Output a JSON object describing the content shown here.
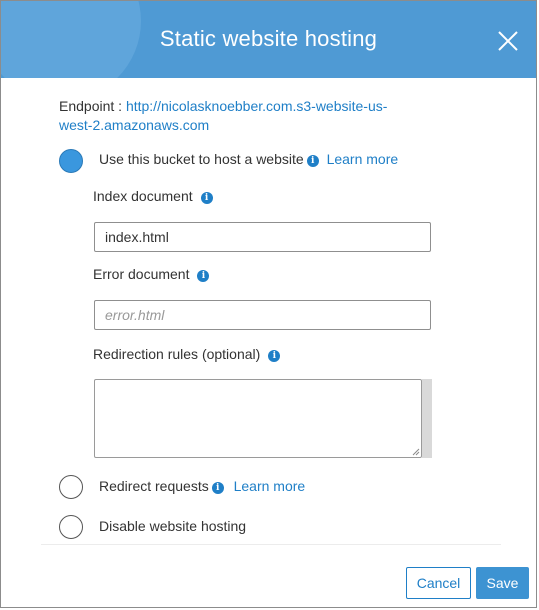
{
  "dialog": {
    "title": "Static website hosting",
    "endpoint_label": "Endpoint : ",
    "endpoint_url_line1": "http://nicolasknoebber.com.s3-website-us-",
    "endpoint_url_line2": "west-2.amazonaws.com"
  },
  "options": {
    "host": {
      "label": "Use this bucket to host a website",
      "learn_more": "Learn more",
      "selected": true
    },
    "redirect": {
      "label": "Redirect requests",
      "learn_more": "Learn more",
      "selected": false
    },
    "disable": {
      "label": "Disable website hosting",
      "selected": false
    }
  },
  "fields": {
    "index_document": {
      "label": "Index document",
      "value": "index.html"
    },
    "error_document": {
      "label": "Error document",
      "value": "",
      "placeholder": "error.html"
    },
    "redirection_rules": {
      "label": "Redirection rules (optional)",
      "value": ""
    }
  },
  "buttons": {
    "cancel": "Cancel",
    "save": "Save"
  },
  "icons": {
    "info": "info-icon",
    "close": "close-icon"
  },
  "colors": {
    "header": "#4f9ad4",
    "link": "#1f7fc7",
    "primary": "#3d93d2"
  }
}
